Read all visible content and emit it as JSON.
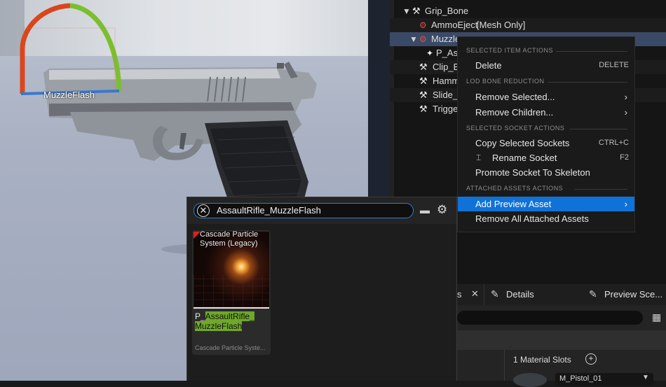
{
  "viewport": {
    "socket_label": "MuzzleFlash"
  },
  "tree": {
    "rows": [
      {
        "label": "Grip_Bone",
        "extra": ""
      },
      {
        "label": "AmmoEject",
        "extra": "[Mesh Only]"
      },
      {
        "label": "Muzzle",
        "extra": ""
      },
      {
        "label": "P_As",
        "extra": ""
      },
      {
        "label": "Clip_B",
        "extra": ""
      },
      {
        "label": "Hamm",
        "extra": ""
      },
      {
        "label": "Slide_",
        "extra": ""
      },
      {
        "label": "Trigge",
        "extra": ""
      }
    ]
  },
  "context_menu": {
    "section_selected_item": "SELECTED ITEM ACTIONS",
    "delete_label": "Delete",
    "delete_shortcut": "DELETE",
    "section_lod": "LOD BONE REDUCTION",
    "remove_selected_label": "Remove Selected...",
    "remove_children_label": "Remove Children...",
    "section_socket": "SELECTED SOCKET ACTIONS",
    "copy_sockets_label": "Copy Selected Sockets",
    "copy_sockets_shortcut": "CTRL+C",
    "rename_socket_label": "Rename Socket",
    "rename_socket_shortcut": "F2",
    "promote_socket_label": "Promote Socket To Skeleton",
    "section_attached": "ATTACHED ASSETS ACTIONS",
    "add_preview_label": "Add Preview Asset",
    "remove_attached_label": "Remove All Attached Assets"
  },
  "asset_picker": {
    "search_value": "AssaultRifle_MuzzleFlash",
    "asset": {
      "type_label": "Cascade Particle System (Legacy)",
      "name_prefix": "P_",
      "name_highlight_1": "AssaultRifle_",
      "name_highlight_2": "MuzzleFlash",
      "subtype": "Cascade Particle Syste..."
    }
  },
  "bottom_panel": {
    "tab_partial": "s",
    "tab_details": "Details",
    "tab_preview": "Preview Sce...",
    "material_slots": "1 Material Slots",
    "material_name": "M_Pistol_01"
  },
  "colors": {
    "accent": "#0f72d8",
    "highlight": "#6fa82a",
    "selection": "#3a4a66"
  }
}
